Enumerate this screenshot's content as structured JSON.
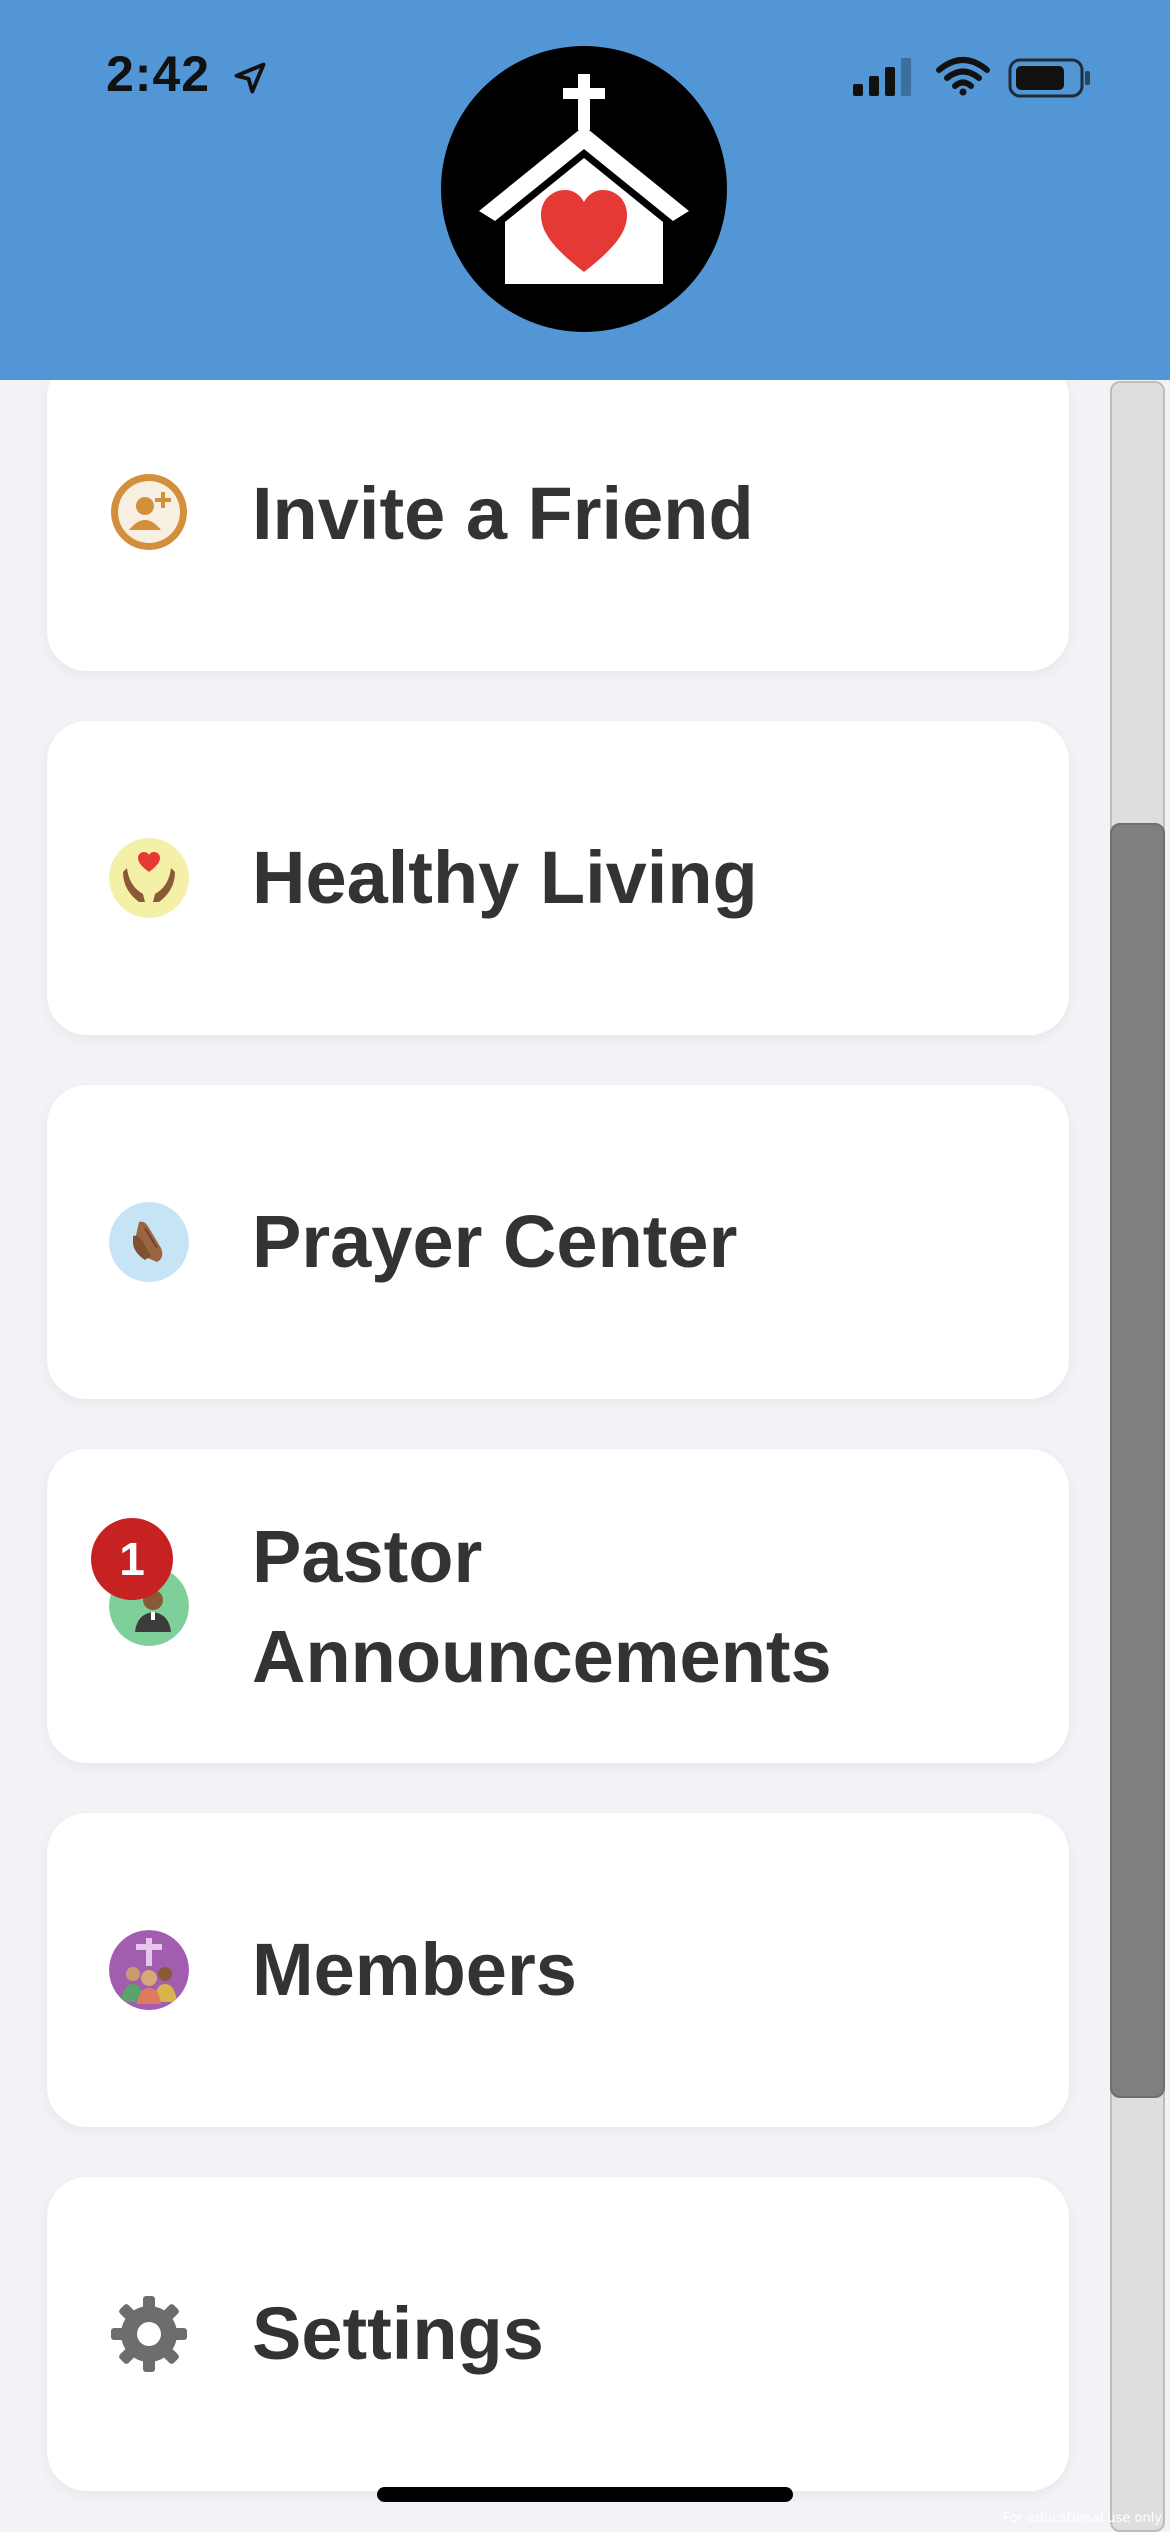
{
  "status_bar": {
    "time": "2:42",
    "icons": [
      "location-arrow-icon",
      "cellular-signal-icon",
      "wifi-icon",
      "battery-icon"
    ]
  },
  "header": {
    "logo_icon": "church-heart-logo",
    "background_color": "#5296d5"
  },
  "menu": {
    "items": [
      {
        "label": "Invite a Friend",
        "icon": "invite-friend-icon"
      },
      {
        "label": "Healthy Living",
        "icon": "heart-hands-icon"
      },
      {
        "label": "Prayer Center",
        "icon": "praying-hands-icon"
      },
      {
        "label": "Pastor Announcements",
        "icon": "pastor-announcement-icon",
        "badge": "1"
      },
      {
        "label": "Members",
        "icon": "members-group-icon"
      },
      {
        "label": "Settings",
        "icon": "gear-icon"
      }
    ]
  },
  "watermark": "For educational use only"
}
